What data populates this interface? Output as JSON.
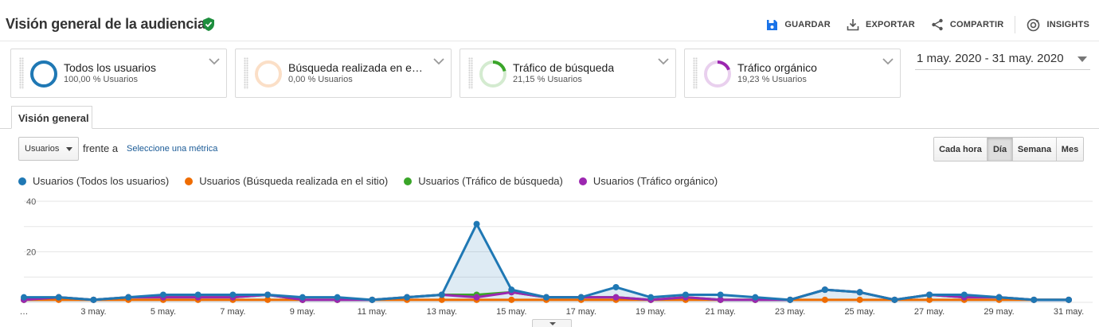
{
  "header": {
    "title": "Visión general de la audiencia",
    "actions": {
      "save": "GUARDAR",
      "export": "EXPORTAR",
      "share": "COMPARTIR",
      "insights": "INSIGHTS"
    }
  },
  "segments": [
    {
      "name": "Todos los usuarios",
      "percent": "100,00 % Usuarios",
      "color": "#1f78b4",
      "fraction": 1.0
    },
    {
      "name": "Búsqueda realizada en el sitio",
      "percent": "0,00 % Usuarios",
      "color": "#ef6c00",
      "fraction": 0.0
    },
    {
      "name": "Tráfico de búsqueda",
      "percent": "21,15 % Usuarios",
      "color": "#3aa529",
      "fraction": 0.2115
    },
    {
      "name": "Tráfico orgánico",
      "percent": "19,23 % Usuarios",
      "color": "#9c27b0",
      "fraction": 0.1923
    }
  ],
  "date_range": "1 may. 2020 - 31 may. 2020",
  "tabs": {
    "overview": "Visión general"
  },
  "controls": {
    "metric": "Usuarios",
    "vs_label": "frente a",
    "select_metric": "Seleccione una métrica",
    "granularity": [
      "Cada hora",
      "Día",
      "Semana",
      "Mes"
    ],
    "granularity_selected": "Día"
  },
  "chart_data": {
    "type": "line",
    "x": [
      "1 may.",
      "2 may.",
      "3 may.",
      "4 may.",
      "5 may.",
      "6 may.",
      "7 may.",
      "8 may.",
      "9 may.",
      "10 may.",
      "11 may.",
      "12 may.",
      "13 may.",
      "14 may.",
      "15 may.",
      "16 may.",
      "17 may.",
      "18 may.",
      "19 may.",
      "20 may.",
      "21 may.",
      "22 may.",
      "23 may.",
      "24 may.",
      "25 may.",
      "26 may.",
      "27 may.",
      "28 may.",
      "29 may.",
      "30 may.",
      "31 may."
    ],
    "tick_labels": [
      "…",
      "3 may.",
      "5 may.",
      "7 may.",
      "9 may.",
      "11 may.",
      "13 may.",
      "15 may.",
      "17 may.",
      "19 may.",
      "21 may.",
      "23 may.",
      "25 may.",
      "27 may.",
      "29 may.",
      "31 may."
    ],
    "y_ticks": [
      "40",
      "20"
    ],
    "ylim": [
      0,
      40
    ],
    "grid": true,
    "legend_position": "top-left",
    "series": [
      {
        "name": "Usuarios (Todos los usuarios)",
        "color": "#1f78b4",
        "values": [
          2,
          2,
          1,
          2,
          3,
          3,
          3,
          3,
          2,
          2,
          1,
          2,
          3,
          31,
          5,
          2,
          2,
          6,
          2,
          3,
          3,
          2,
          1,
          5,
          4,
          1,
          3,
          3,
          2,
          1,
          1
        ]
      },
      {
        "name": "Usuarios (Búsqueda realizada en el sitio)",
        "color": "#ef6c00",
        "values": [
          1,
          1,
          1,
          1,
          1,
          1,
          1,
          1,
          1,
          1,
          1,
          1,
          1,
          1,
          1,
          1,
          1,
          1,
          1,
          1,
          1,
          1,
          1,
          1,
          1,
          1,
          1,
          1,
          1,
          1,
          1
        ]
      },
      {
        "name": "Usuarios (Tráfico de búsqueda)",
        "color": "#3aa529",
        "values": [
          1,
          2,
          1,
          2,
          2,
          2,
          2,
          3,
          1,
          1,
          1,
          2,
          3,
          3,
          4,
          2,
          2,
          2,
          1,
          2,
          1,
          1,
          1,
          5,
          4,
          1,
          3,
          2,
          2,
          1,
          1
        ]
      },
      {
        "name": "Usuarios (Tráfico orgánico)",
        "color": "#9c27b0",
        "values": [
          1,
          2,
          1,
          2,
          2,
          2,
          2,
          3,
          1,
          1,
          1,
          2,
          3,
          2,
          4,
          2,
          2,
          2,
          1,
          2,
          1,
          1,
          1,
          5,
          4,
          1,
          3,
          2,
          2,
          1,
          1
        ]
      }
    ]
  }
}
